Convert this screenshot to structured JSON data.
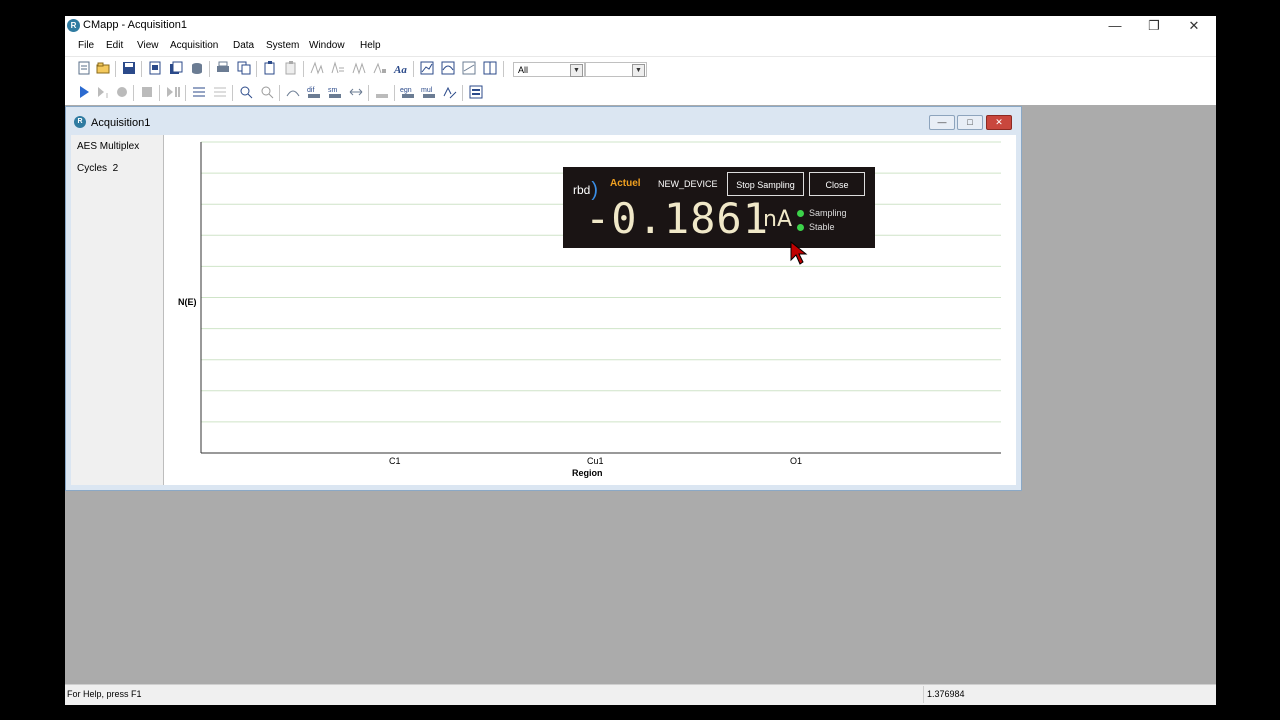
{
  "window": {
    "title": "CMapp - Acquisition1",
    "logo": "R"
  },
  "menu": [
    "File",
    "Edit",
    "View",
    "Acquisition",
    "Data",
    "System",
    "Window",
    "Help"
  ],
  "toolbar": {
    "combo_value": "All"
  },
  "child": {
    "title": "Acquisition1",
    "logo": "R"
  },
  "left_panel": {
    "mode": "AES Multiplex",
    "cycles_label": "Cycles",
    "cycles_value": "2"
  },
  "chart_data": {
    "type": "table",
    "ylabel": "N(E)",
    "xlabel": "Region",
    "categories": [
      "C1",
      "Cu1",
      "O1"
    ],
    "grid": true,
    "series": []
  },
  "overlay": {
    "brand": "rbd",
    "product": "Actuel",
    "device": "NEW_DEVICE",
    "stop_button": "Stop Sampling",
    "close_button": "Close",
    "reading": "-0.1861",
    "unit": "nA",
    "status1": "Sampling",
    "status2": "Stable",
    "status_color": "#3cd24a"
  },
  "statusbar": {
    "help": "For Help, press F1",
    "value": "1.376984"
  }
}
